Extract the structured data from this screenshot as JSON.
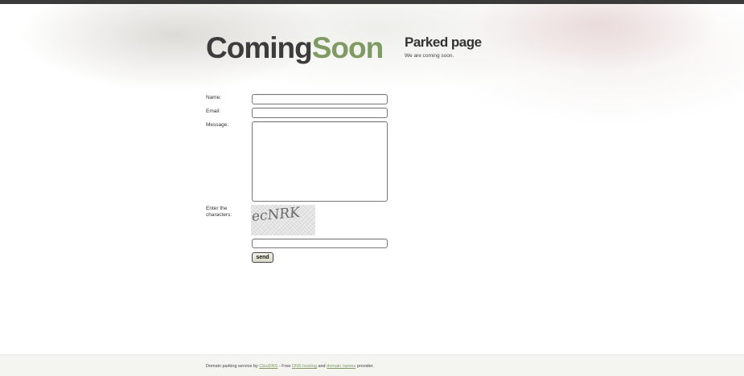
{
  "header": {
    "logo_part1": "Coming",
    "logo_part2": "Soon",
    "parked_title": "Parked page",
    "parked_subtitle": "We are coming soon."
  },
  "form": {
    "name_label": "Name:",
    "name_value": "",
    "email_label": "Email:",
    "email_value": "",
    "message_label": "Message:",
    "message_value": "",
    "captcha_label_line1": "Enter the",
    "captcha_label_line2": "characters:",
    "captcha_text": "ecNRK",
    "captcha_value": "",
    "send_label": "send"
  },
  "footer": {
    "prefix": "Domain parking service by",
    "link1": "ClouDNS",
    "middle": "- Free",
    "link2": "DNS hosting",
    "and": "and",
    "link3": "domain names",
    "suffix": "provider."
  },
  "colors": {
    "accent_green": "#7f9a63",
    "top_bar": "#3a3a3a",
    "logo_dark": "#3c3c3c"
  }
}
